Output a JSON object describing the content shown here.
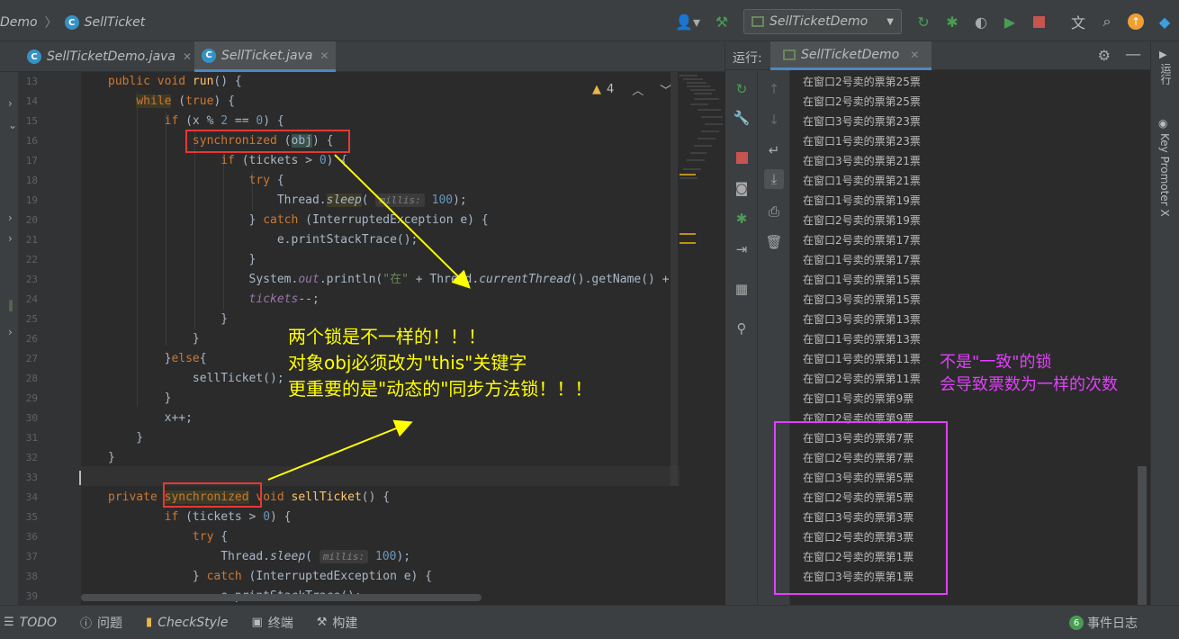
{
  "breadcrumbs": {
    "project": "Demo",
    "file": "SellTicket"
  },
  "toolbar": {
    "run_config": "SellTicketDemo"
  },
  "editor_tabs": [
    {
      "label": "SellTicketDemo.java"
    },
    {
      "label": "SellTicket.java"
    }
  ],
  "editor": {
    "warnings": "4",
    "line_numbers": [
      "13",
      "14",
      "15",
      "16",
      "17",
      "18",
      "19",
      "20",
      "21",
      "22",
      "23",
      "24",
      "25",
      "26",
      "27",
      "28",
      "29",
      "30",
      "31",
      "32",
      "33",
      "34",
      "35",
      "36",
      "37",
      "38",
      "39"
    ],
    "hint_millis": "millis:"
  },
  "run_panel": {
    "label": "运行:",
    "tab": "SellTicketDemo",
    "console_lines": [
      "在窗口2号卖的票第25票",
      "在窗口2号卖的票第25票",
      "在窗口3号卖的票第23票",
      "在窗口1号卖的票第23票",
      "在窗口3号卖的票第21票",
      "在窗口1号卖的票第21票",
      "在窗口1号卖的票第19票",
      "在窗口2号卖的票第19票",
      "在窗口2号卖的票第17票",
      "在窗口1号卖的票第17票",
      "在窗口1号卖的票第15票",
      "在窗口3号卖的票第15票",
      "在窗口3号卖的票第13票",
      "在窗口1号卖的票第13票",
      "在窗口1号卖的票第11票",
      "在窗口2号卖的票第11票",
      "在窗口1号卖的票第9票",
      "在窗口2号卖的票第9票",
      "在窗口3号卖的票第7票",
      "在窗口2号卖的票第7票",
      "在窗口3号卖的票第5票",
      "在窗口2号卖的票第5票",
      "在窗口3号卖的票第3票",
      "在窗口2号卖的票第3票",
      "在窗口2号卖的票第1票",
      "在窗口3号卖的票第1票"
    ]
  },
  "right_strip": {
    "run": "运行",
    "key_promoter": "Key Promoter X"
  },
  "statusbar": {
    "todo": "TODO",
    "problems": "问题",
    "checkstyle": "CheckStyle",
    "terminal": "终端",
    "build": "构建",
    "events_count": "6",
    "events": "事件日志"
  },
  "annotations": {
    "yellow_note": [
      "两个锁是不一样的！！！",
      "对象obj必须改为\"this\"关键字",
      "更重要的是\"动态的\"同步方法锁！！！"
    ],
    "magenta_note": [
      "不是\"一致\"的锁",
      "会导致票数为一样的次数"
    ],
    "yellow_color": "#ffff00",
    "magenta_color": "#e040fb",
    "red_color": "#e53935"
  },
  "colors": {
    "accent": "#4a88c7",
    "keyword": "#cc7832",
    "function": "#ffc66d",
    "number": "#6897bb",
    "string": "#6a8759"
  }
}
